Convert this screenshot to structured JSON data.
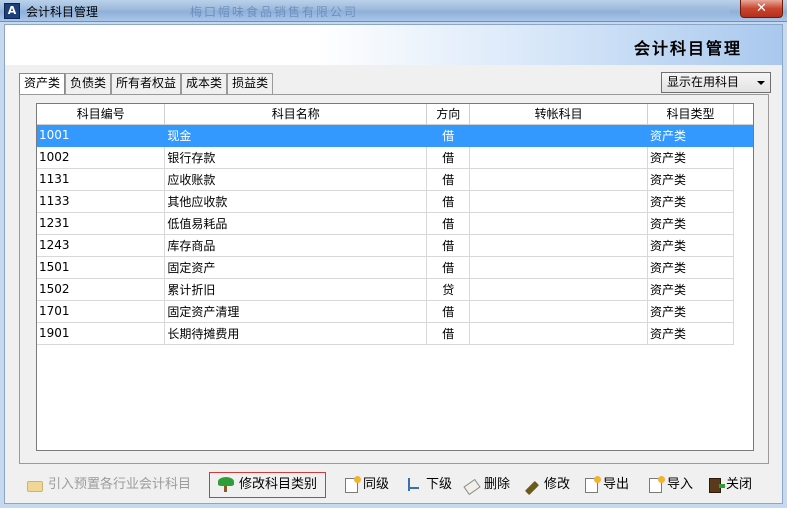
{
  "window": {
    "title": "会计科目管理",
    "background_title": "梅口帽味食品销售有限公司",
    "close_symbol": "✕"
  },
  "header": {
    "title": "会计科目管理"
  },
  "tabs": [
    {
      "label": "资产类",
      "active": true
    },
    {
      "label": "负债类",
      "active": false
    },
    {
      "label": "所有者权益",
      "active": false
    },
    {
      "label": "成本类",
      "active": false
    },
    {
      "label": "损益类",
      "active": false
    }
  ],
  "view_filter": {
    "selected": "显示在用科目"
  },
  "table": {
    "columns": [
      "科目编号",
      "科目名称",
      "方向",
      "转帐科目",
      "科目类型"
    ],
    "rows": [
      {
        "code": "1001",
        "name": "现金",
        "direction": "借",
        "transfer": "",
        "type": "资产类",
        "selected": true
      },
      {
        "code": "1002",
        "name": "银行存款",
        "direction": "借",
        "transfer": "",
        "type": "资产类"
      },
      {
        "code": "1131",
        "name": "应收账款",
        "direction": "借",
        "transfer": "",
        "type": "资产类"
      },
      {
        "code": "1133",
        "name": "其他应收款",
        "direction": "借",
        "transfer": "",
        "type": "资产类"
      },
      {
        "code": "1231",
        "name": "低值易耗品",
        "direction": "借",
        "transfer": "",
        "type": "资产类"
      },
      {
        "code": "1243",
        "name": "库存商品",
        "direction": "借",
        "transfer": "",
        "type": "资产类"
      },
      {
        "code": "1501",
        "name": "固定资产",
        "direction": "借",
        "transfer": "",
        "type": "资产类"
      },
      {
        "code": "1502",
        "name": "累计折旧",
        "direction": "贷",
        "transfer": "",
        "type": "资产类"
      },
      {
        "code": "1701",
        "name": "固定资产清理",
        "direction": "借",
        "transfer": "",
        "type": "资产类"
      },
      {
        "code": "1901",
        "name": "长期待摊费用",
        "direction": "借",
        "transfer": "",
        "type": "资产类"
      }
    ]
  },
  "toolbar": {
    "import_label": "引入预置各行业会计科目",
    "modify_type_label": "修改科目类别",
    "same_level_label": "同级",
    "sub_level_label": "下级",
    "delete_label": "删除",
    "edit_label": "修改",
    "export_label": "导出",
    "import2_label": "导入",
    "close_label": "关闭"
  },
  "colors": {
    "selection": "#3399ff",
    "highlight_border": "#d03a3a"
  }
}
